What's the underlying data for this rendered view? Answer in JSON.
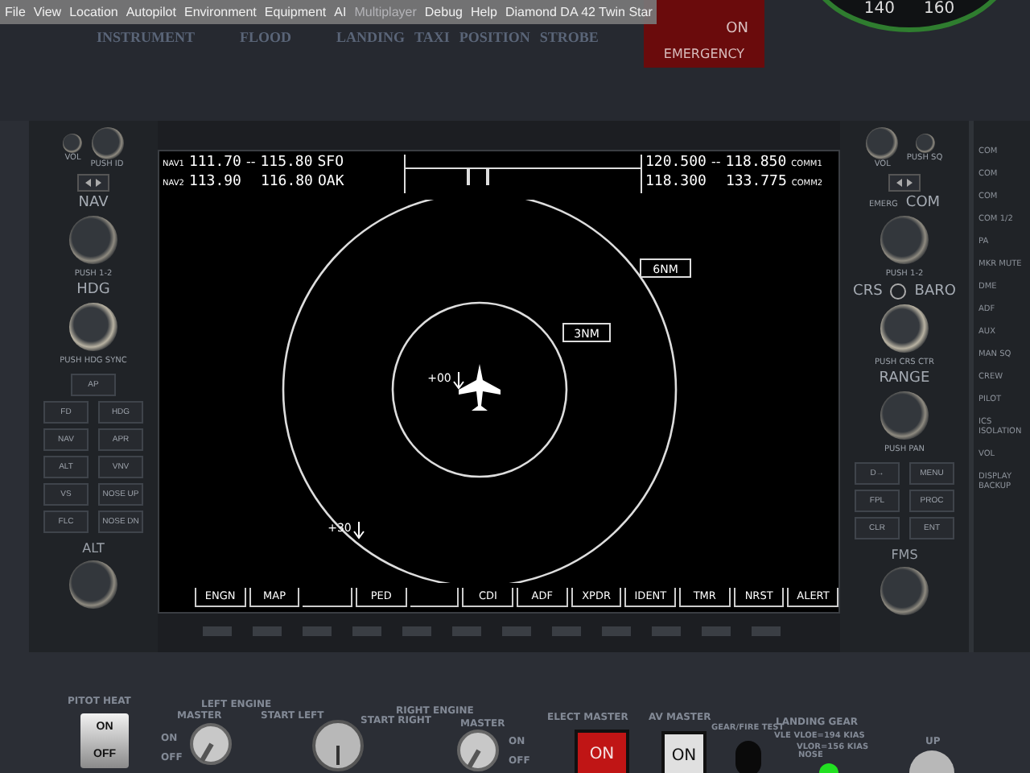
{
  "menu_bar": {
    "items": [
      {
        "label": "File",
        "disabled": false
      },
      {
        "label": "View",
        "disabled": false
      },
      {
        "label": "Location",
        "disabled": false
      },
      {
        "label": "Autopilot",
        "disabled": false
      },
      {
        "label": "Environment",
        "disabled": false
      },
      {
        "label": "Equipment",
        "disabled": false
      },
      {
        "label": "AI",
        "disabled": false
      },
      {
        "label": "Multiplayer",
        "disabled": true
      },
      {
        "label": "Debug",
        "disabled": false
      },
      {
        "label": "Help",
        "disabled": false
      }
    ],
    "aircraft": "Diamond DA 42 Twin Star"
  },
  "light_labels": [
    "INSTRUMENT",
    "FLOOD",
    "LANDING",
    "TAXI",
    "POSITION",
    "STROBE"
  ],
  "emergency": {
    "state": "ON",
    "label": "EMERGENCY"
  },
  "airspeed_gauge": {
    "labels": [
      "140",
      "160"
    ]
  },
  "pfd": {
    "nav": [
      {
        "label": "NAV1",
        "active": "111.70",
        "separator": "--",
        "standby": "115.80",
        "ident": "SFO"
      },
      {
        "label": "NAV2",
        "active": "113.90",
        "standby": "116.80",
        "ident": "OAK"
      }
    ],
    "com": [
      {
        "active": "120.500",
        "separator": "--",
        "standby": "118.850",
        "label": "COMM1"
      },
      {
        "active": "118.300",
        "standby": "133.775",
        "label": "COMM2"
      }
    ],
    "range_rings": [
      {
        "label": "6NM"
      },
      {
        "label": "3NM"
      }
    ],
    "traffic": [
      {
        "label": "+00"
      },
      {
        "label": "+30"
      }
    ],
    "softkeys": [
      {
        "kind": "label",
        "label": "ENGN"
      },
      {
        "kind": "label",
        "label": "MAP"
      },
      {
        "kind": "blank"
      },
      {
        "kind": "label",
        "label": "PED"
      },
      {
        "kind": "blank"
      },
      {
        "kind": "label",
        "label": "CDI"
      },
      {
        "kind": "label",
        "label": "ADF"
      },
      {
        "kind": "label",
        "label": "XPDR"
      },
      {
        "kind": "label",
        "label": "IDENT"
      },
      {
        "kind": "label",
        "label": "TMR"
      },
      {
        "kind": "label",
        "label": "NRST"
      },
      {
        "kind": "label",
        "label": "ALERT"
      }
    ]
  },
  "left_bezel": {
    "vol_label": "VOL",
    "vol_push": "PUSH ID",
    "nav_label": "NAV",
    "nav_push": "PUSH 1-2",
    "hdg_label": "HDG",
    "hdg_push": "PUSH HDG SYNC",
    "buttons": [
      [
        "AP"
      ],
      [
        "FD",
        "HDG"
      ],
      [
        "NAV",
        "APR"
      ],
      [
        "ALT",
        "VNV"
      ],
      [
        "VS",
        "NOSE UP"
      ],
      [
        "FLC",
        "NOSE DN"
      ]
    ],
    "alt_label": "ALT"
  },
  "right_bezel": {
    "vol_label": "VOL",
    "vol_push": "PUSH SQ",
    "emerg_label": "EMERG",
    "com_label": "COM",
    "com_push": "PUSH 1-2",
    "crs_label": "CRS",
    "baro_label": "BARO",
    "crs_push": "PUSH CRS CTR",
    "range_label": "RANGE",
    "range_push": "PUSH PAN",
    "buttons": [
      [
        "D→",
        "MENU"
      ],
      [
        "FPL",
        "PROC"
      ],
      [
        "CLR",
        "ENT"
      ]
    ],
    "fms_label": "FMS"
  },
  "audio_panel": {
    "items": [
      "COM",
      "COM",
      "COM",
      "COM 1/2",
      "PA",
      "MKR MUTE",
      "DME",
      "ADF",
      "AUX",
      "MAN SQ",
      "CREW",
      "PILOT",
      "ICS ISOLATION",
      "VOL",
      "DISPLAY BACKUP"
    ]
  },
  "lower_panel": {
    "pitot": {
      "label": "PITOT HEAT",
      "on_label": "ON",
      "off_label": "OFF",
      "on": true
    },
    "left_engine": {
      "title": "LEFT ENGINE",
      "master": "MASTER",
      "start": "START LEFT",
      "on_label": "ON",
      "off_label": "OFF",
      "on": false,
      "start_on": false
    },
    "right_engine": {
      "title": "RIGHT ENGINE",
      "start": "START RIGHT",
      "master": "MASTER",
      "on_label": "ON",
      "off_label": "OFF",
      "on": false
    },
    "elect_master": {
      "label": "ELECT MASTER",
      "state": "ON"
    },
    "av_master": {
      "label": "AV MASTER",
      "state": "ON"
    },
    "gear_fire_test": "GEAR/FIRE TEST",
    "landing_gear": {
      "title": "LANDING GEAR",
      "limits": [
        "VLE VLOE=194 KIAS",
        "VLOR=156 KIAS"
      ],
      "nose_label": "NOSE",
      "nose_on": true,
      "up_label": "UP"
    }
  }
}
